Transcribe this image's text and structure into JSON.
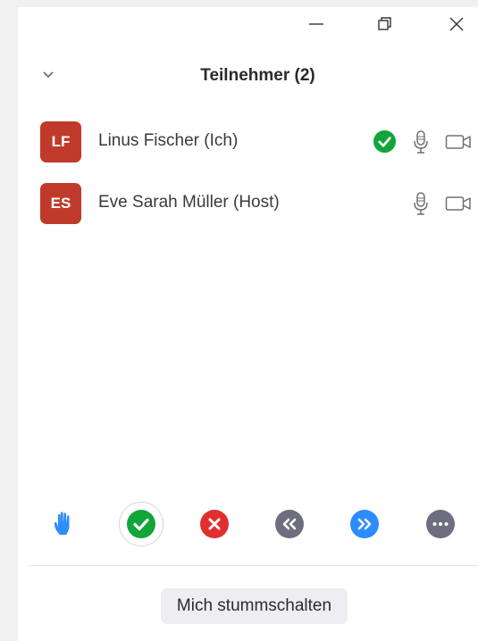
{
  "window": {
    "controls": {
      "minimize_icon": "minimize-icon",
      "restore_icon": "restore-icon",
      "close_icon": "close-icon"
    }
  },
  "panel": {
    "title": "Teilnehmer (2)",
    "collapse_icon": "chevron-down-icon"
  },
  "participants": [
    {
      "initials": "LF",
      "name": "Linus Fischer (Ich)",
      "avatar_color": "#c03a2b",
      "status": "green-check",
      "mic_icon": "microphone-icon",
      "video_icon": "video-camera-icon"
    },
    {
      "initials": "ES",
      "name": "Eve Sarah Müller (Host)",
      "avatar_color": "#c03a2b",
      "mic_icon": "microphone-icon",
      "video_icon": "video-camera-icon"
    }
  ],
  "reactions": [
    {
      "icon": "raise-hand-icon",
      "color": "#2d8cff"
    },
    {
      "icon": "yes-check-icon",
      "color": "#12a53a"
    },
    {
      "icon": "no-x-icon",
      "color": "#e02f2f"
    },
    {
      "icon": "go-slower-icon",
      "color": "#6e6e80"
    },
    {
      "icon": "go-faster-icon",
      "color": "#2d8cff"
    },
    {
      "icon": "more-icon",
      "color": "#6e6e80"
    }
  ],
  "footer": {
    "mute_label": "Mich stummschalten"
  },
  "colors": {
    "avatar": "#c03a2b",
    "check_green": "#12a53a",
    "blue": "#2d8cff",
    "red": "#e02f2f",
    "grey": "#6e6e80"
  }
}
